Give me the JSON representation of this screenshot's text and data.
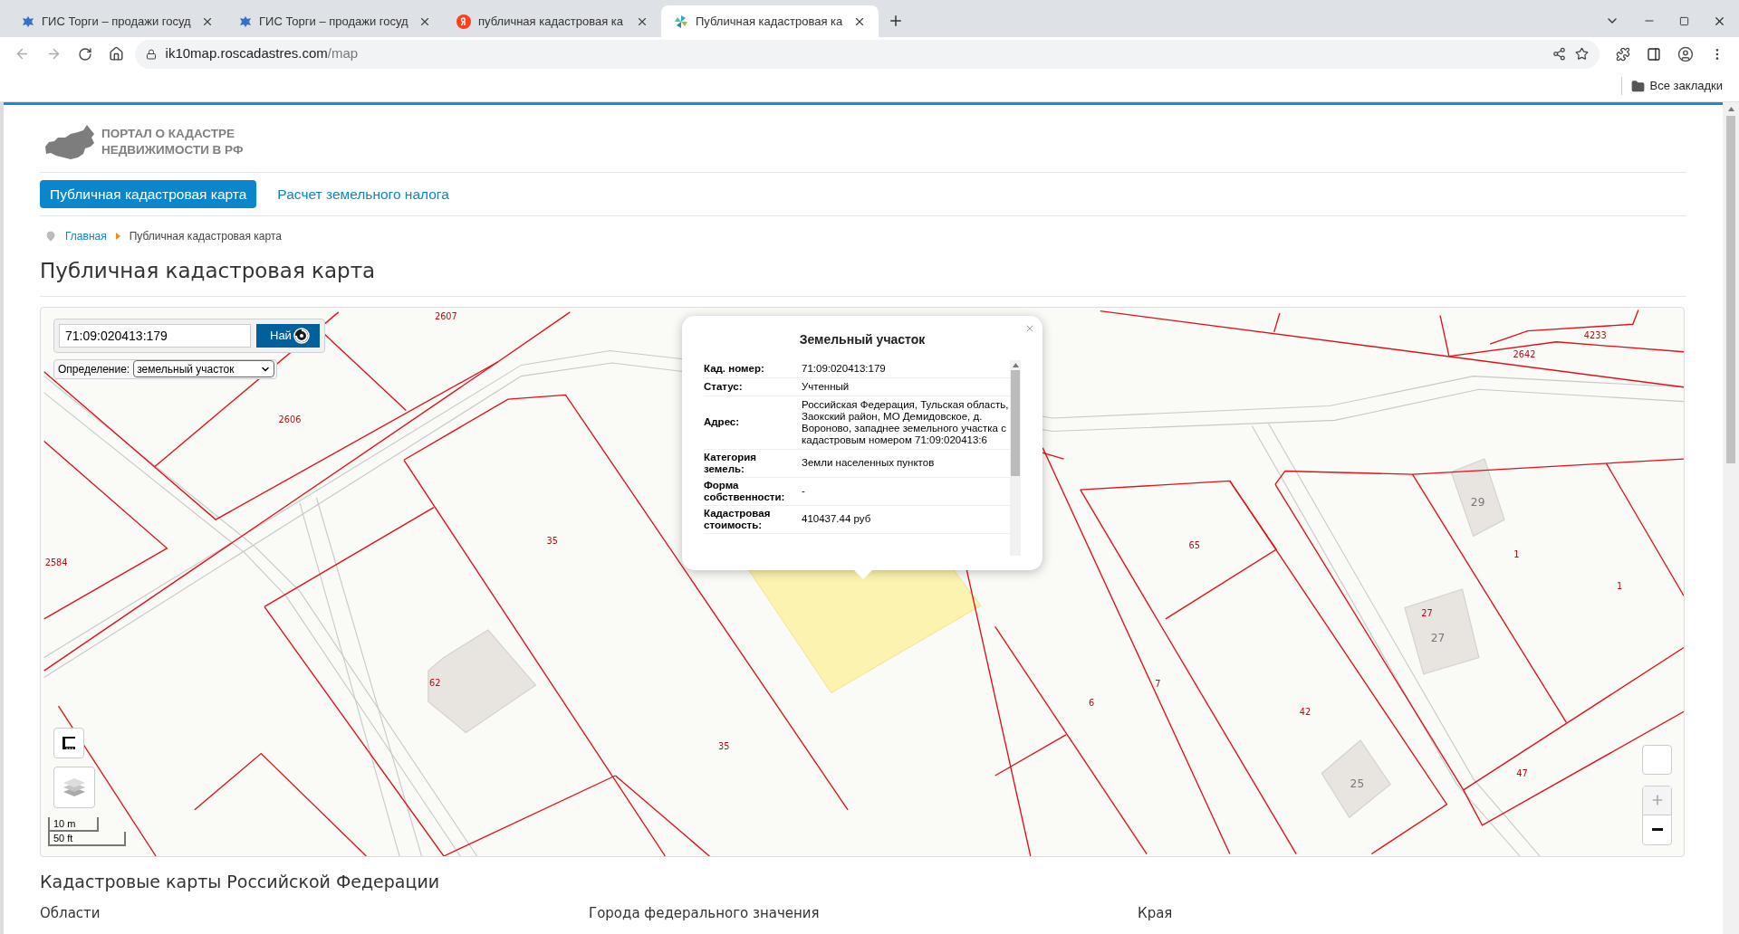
{
  "browser": {
    "tabs": [
      {
        "title": "ГИС Торги – продажи госуд",
        "kind": "emblem",
        "selected": false
      },
      {
        "title": "ГИС Торги – продажи госуд",
        "kind": "emblem",
        "selected": false
      },
      {
        "title": "публичная кадастровая ка",
        "kind": "search",
        "selected": false
      },
      {
        "title": "Публичная кадастровая ка",
        "kind": "map",
        "selected": true
      }
    ],
    "url": {
      "host": "ik10map.roscadastres.com",
      "path": "/map"
    },
    "bookmarks": "Все закладки"
  },
  "logo": [
    "ПОРТАЛ О КАДАСТРЕ",
    "НЕДВИЖИМОСТИ В РФ"
  ],
  "nav": [
    {
      "label": "Публичная кадастровая карта",
      "selected": true
    },
    {
      "label": "Расчет земельного налога",
      "selected": false
    }
  ],
  "breadcrumb": [
    {
      "label": "Главная",
      "kind": "link"
    },
    {
      "label": "Публичная кадастровая карта",
      "kind": "current"
    }
  ],
  "title": "Публичная кадастровая карта",
  "map": {
    "search": {
      "value": "71:09:020413:179",
      "button": "Най"
    },
    "definition": {
      "label": "Определение:",
      "value": "земельный участок"
    },
    "labels": [
      {
        "text": "2607",
        "kind": "parcel"
      },
      {
        "text": "2606",
        "kind": "parcel"
      },
      {
        "text": "2584",
        "kind": "parcel"
      },
      {
        "text": "35",
        "kind": "parcel"
      },
      {
        "text": "62",
        "kind": "parcel"
      },
      {
        "text": "35",
        "kind": "parcel"
      },
      {
        "text": "65",
        "kind": "parcel"
      },
      {
        "text": "7",
        "kind": "parcel"
      },
      {
        "text": "6",
        "kind": "parcel"
      },
      {
        "text": "42",
        "kind": "parcel"
      },
      {
        "text": "29",
        "kind": "building"
      },
      {
        "text": "1",
        "kind": "parcel"
      },
      {
        "text": "1",
        "kind": "parcel"
      },
      {
        "text": "27",
        "kind": "parcel"
      },
      {
        "text": "27",
        "kind": "building"
      },
      {
        "text": "25",
        "kind": "building"
      },
      {
        "text": "47",
        "kind": "parcel"
      },
      {
        "text": "4233",
        "kind": "parcel"
      },
      {
        "text": "2642",
        "kind": "parcel"
      }
    ],
    "popup": {
      "title": "Земельный участок",
      "rows": [
        {
          "label": "Кад. номер:",
          "value": "71:09:020413:179"
        },
        {
          "label": "Статус:",
          "value": "Учтенный"
        },
        {
          "label": "Адрес:",
          "value": "Российская Федерация, Тульская область, Заокский район, МО Демидовское, д. Вороново, западнее земельного участка с кадастровым номером 71:09:020413:6"
        },
        {
          "label": "Категория земель:",
          "value": "Земли населенных пунктов"
        },
        {
          "label": "Форма собственности:",
          "value": "-"
        },
        {
          "label": "Кадастровая стоимость:",
          "value": "410437.44 руб"
        }
      ]
    },
    "scale": [
      "10 m",
      "50 ft"
    ]
  },
  "section": {
    "title": "Кадастровые карты Российской Федерации",
    "columns": [
      "Области",
      "Города федерального значения",
      "Края"
    ]
  }
}
